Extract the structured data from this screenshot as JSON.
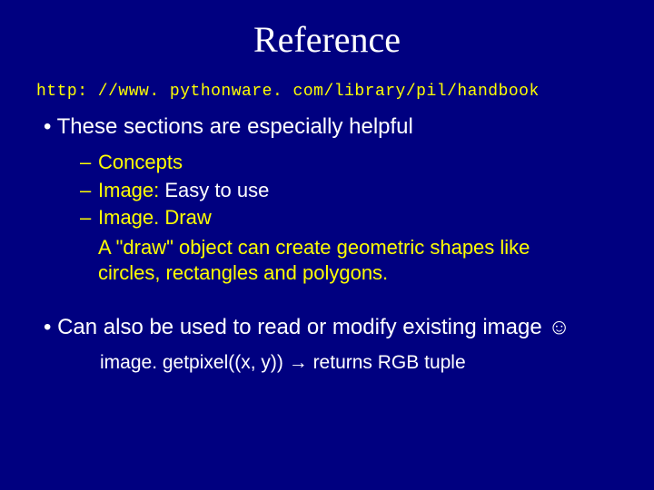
{
  "title": "Reference",
  "url": "http: //www. pythonware. com/library/pil/handbook",
  "bullet1": "• These sections are especially helpful",
  "sub": {
    "dash": "–",
    "item1": "Concepts",
    "item2_label": "Image:",
    "item2_note": "  Easy to use",
    "item3": "Image. Draw",
    "desc": "A \"draw\" object can create geometric shapes like circles, rectangles and polygons."
  },
  "bullet2_pre": "• Can also be used to read or modify existing image ",
  "bullet2_smile": "☺",
  "code_pre": "image. getpixel((x, y))  ",
  "code_arrow": "→",
  "code_post": "  returns RGB tuple"
}
